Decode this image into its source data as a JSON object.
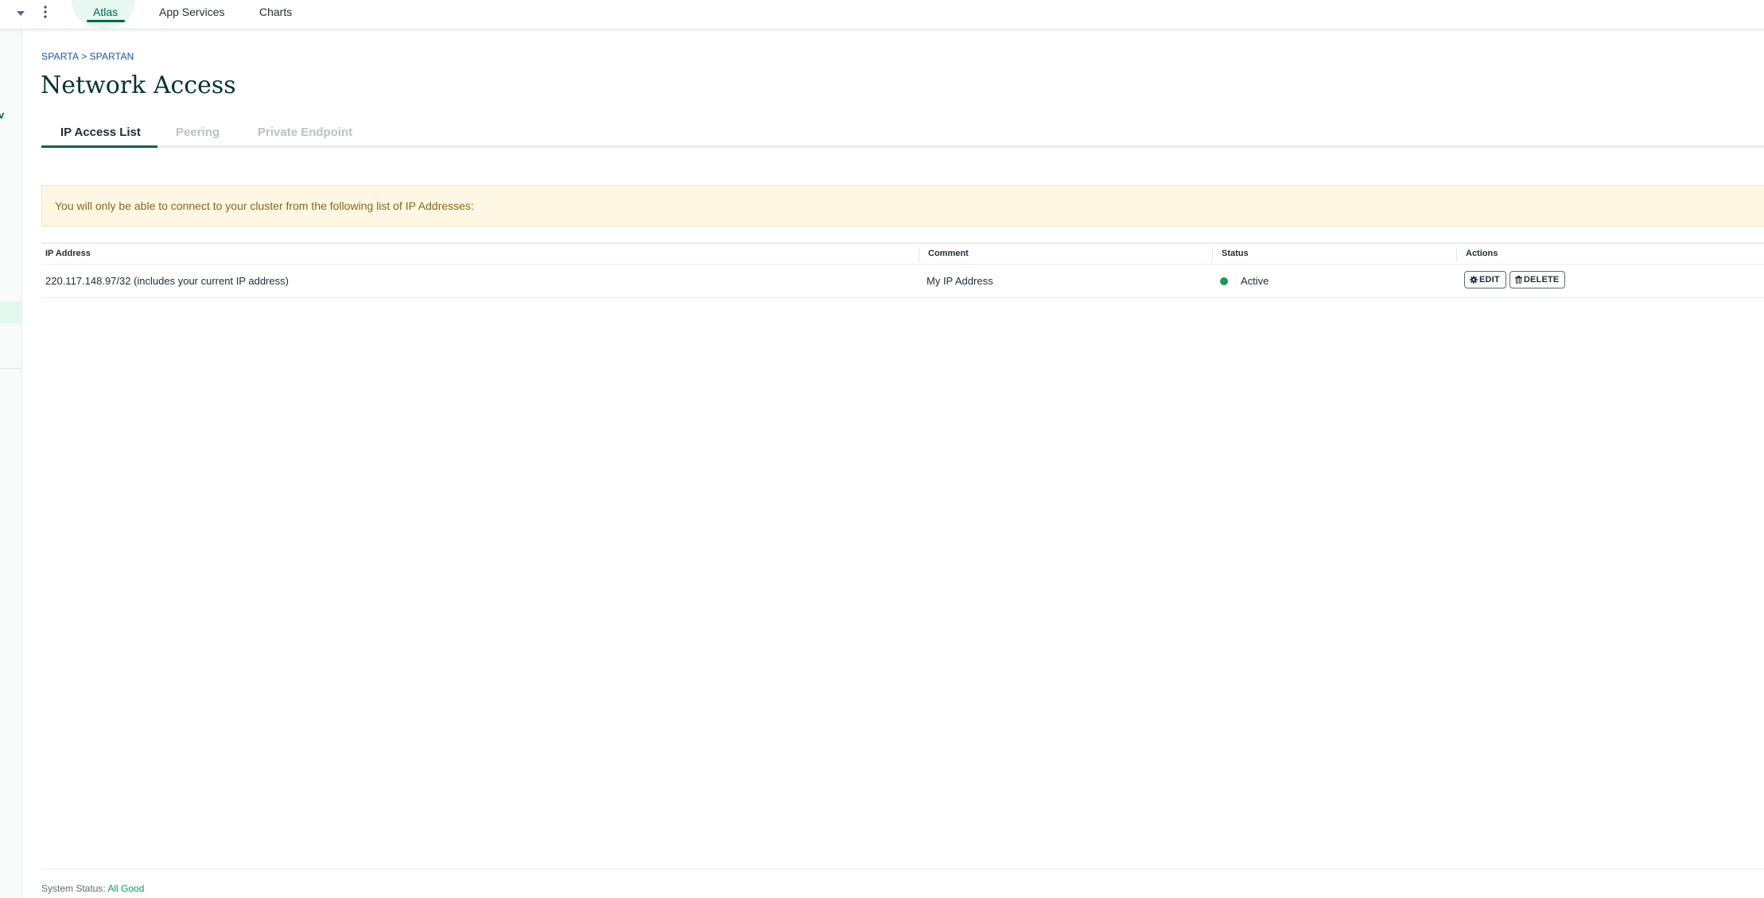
{
  "topnav": {
    "tabs": [
      {
        "label": "Atlas",
        "active": true
      },
      {
        "label": "App Services",
        "active": false
      },
      {
        "label": "Charts",
        "active": false
      }
    ]
  },
  "leftrail": {
    "fragment_text": "v"
  },
  "breadcrumb": {
    "org": "SPARTA",
    "separator": ">",
    "project": "SPARTAN"
  },
  "page": {
    "title": "Network Access"
  },
  "subtabs": [
    {
      "label": "IP Access List",
      "active": true
    },
    {
      "label": "Peering",
      "active": false
    },
    {
      "label": "Private Endpoint",
      "active": false
    }
  ],
  "banner": {
    "text": "You will only be able to connect to your cluster from the following list of IP Addresses:"
  },
  "table": {
    "columns": [
      "IP Address",
      "Comment",
      "Status",
      "Actions"
    ],
    "rows": [
      {
        "ip": "220.117.148.97/32  (includes your current IP address)",
        "comment": "My IP Address",
        "status": "Active",
        "status_color": "#1a9b54",
        "actions": [
          "EDIT",
          "DELETE"
        ]
      }
    ]
  },
  "footer": {
    "label": "System Status:",
    "status": "All Good"
  },
  "colors": {
    "brand_green": "#00684a",
    "link_blue": "#1254b7",
    "banner_bg": "#fef7e3",
    "banner_text": "#86681d",
    "status_green": "#00a35c"
  },
  "icons": [
    "caret-down-icon",
    "kebab-menu-icon",
    "gear-icon",
    "trash-icon"
  ]
}
